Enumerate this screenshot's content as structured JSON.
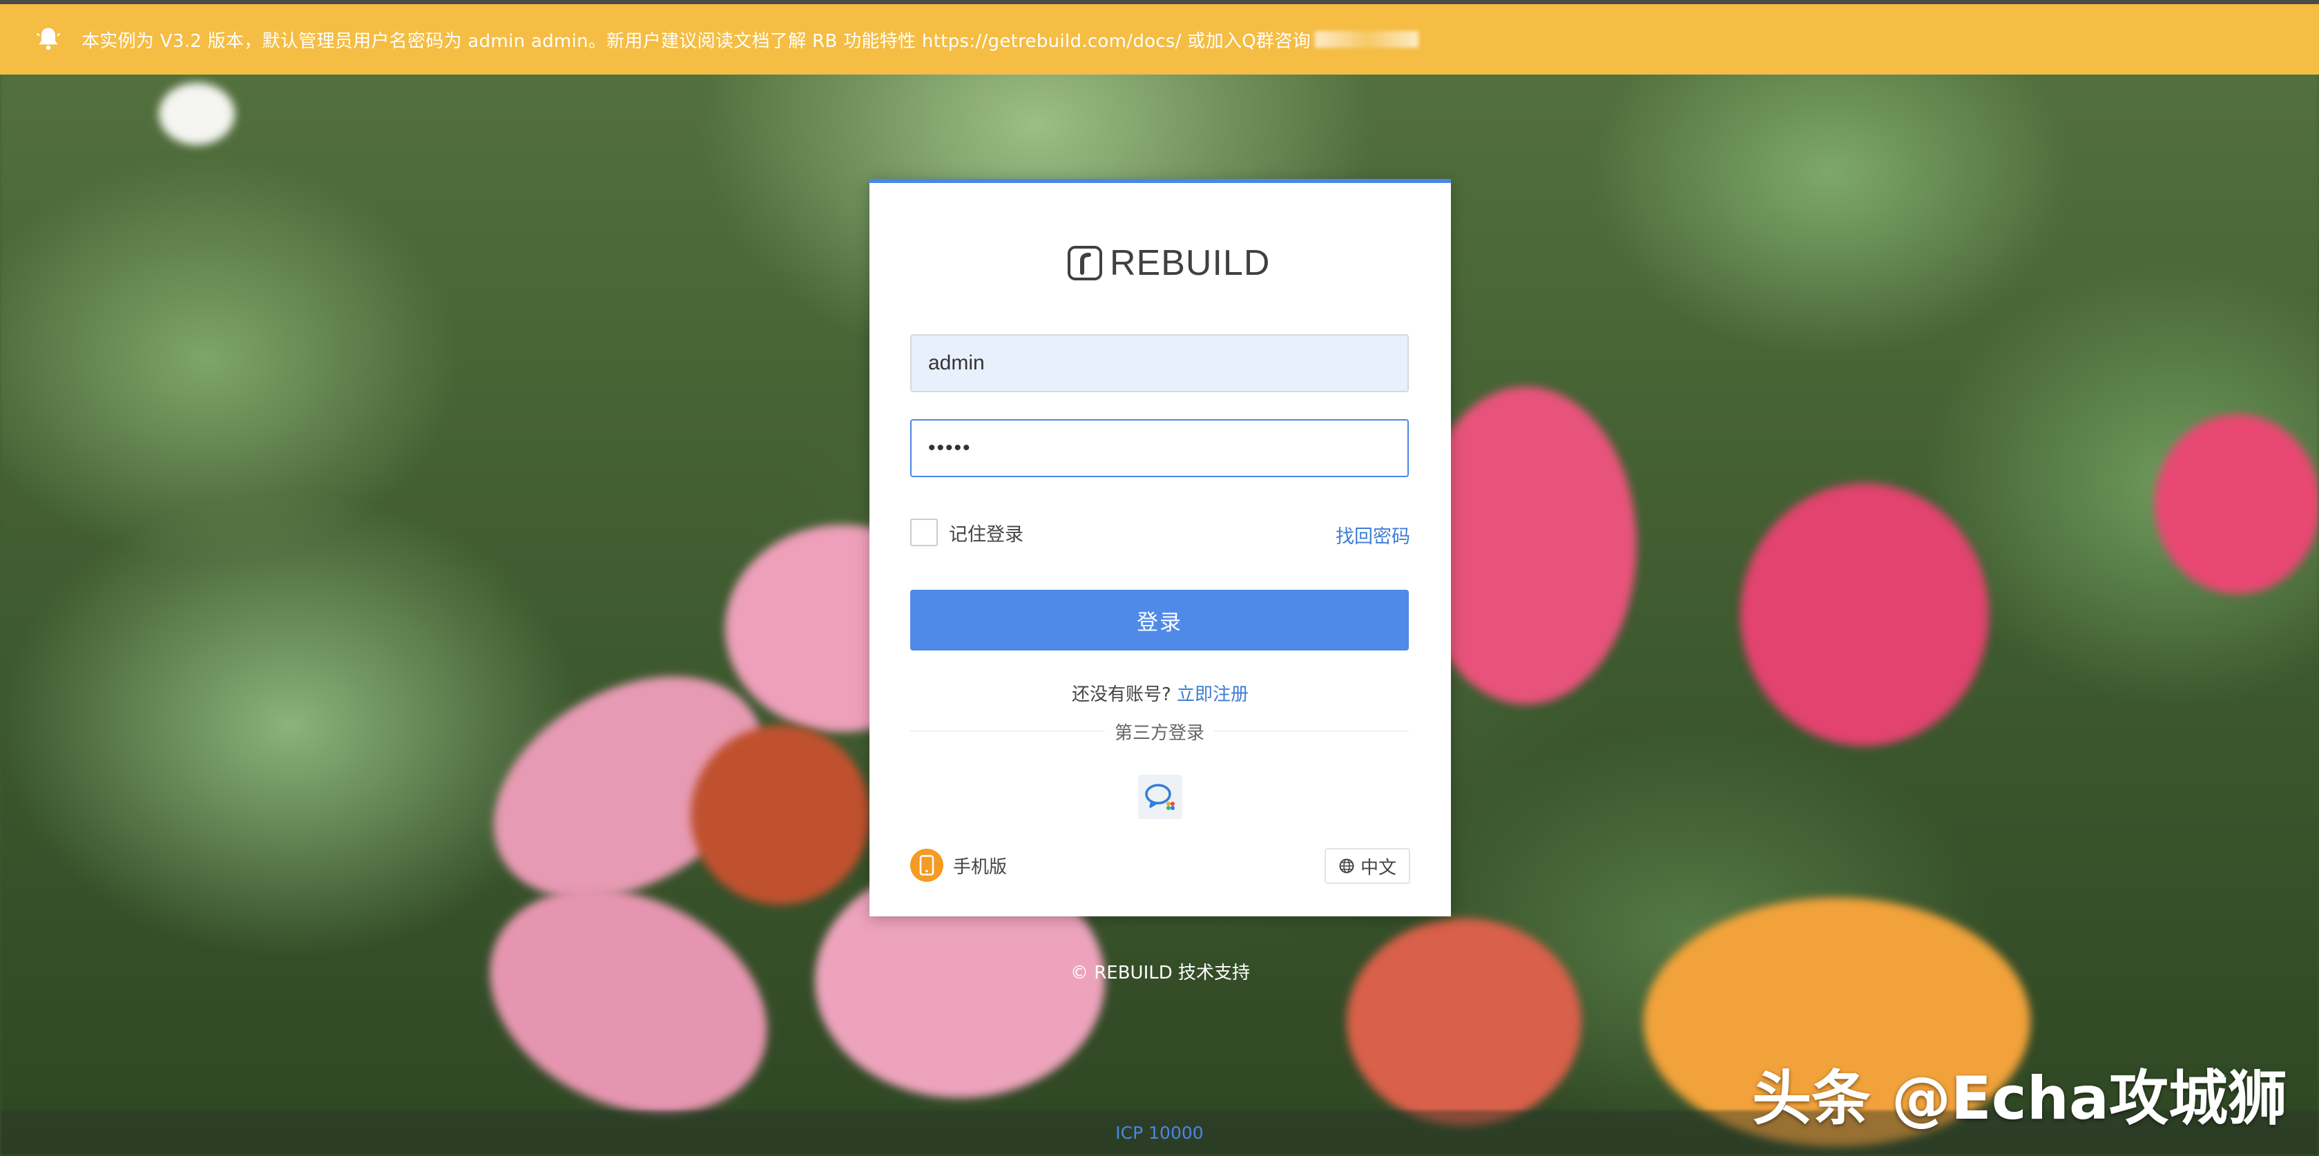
{
  "notice": {
    "text": "本实例为 V3.2 版本，默认管理员用户名密码为 admin admin。新用户建议阅读文档了解 RB 功能特性 https://getrebuild.com/docs/ 或加入Q群咨询",
    "icon": "bell-icon",
    "background": "#f5bd43"
  },
  "brand": {
    "name": "REBUILD"
  },
  "login": {
    "username_value": "admin",
    "password_value": "•••••",
    "remember_label": "记住登录",
    "forgot_label": "找回密码",
    "submit_label": "登录",
    "no_account_text": "还没有账号?",
    "register_label": "立即注册",
    "third_party_label": "第三方登录",
    "third_party_icon": "wechat-work-icon",
    "mobile_label": "手机版",
    "mobile_icon": "phone-icon",
    "language_label": "中文",
    "language_icon": "globe-icon",
    "accent": "#4f8ae8"
  },
  "footer": {
    "support_text": "© REBUILD 技术支持",
    "icp_text": "ICP 10000"
  },
  "watermark": {
    "text": "头条 @Echa攻城狮"
  }
}
